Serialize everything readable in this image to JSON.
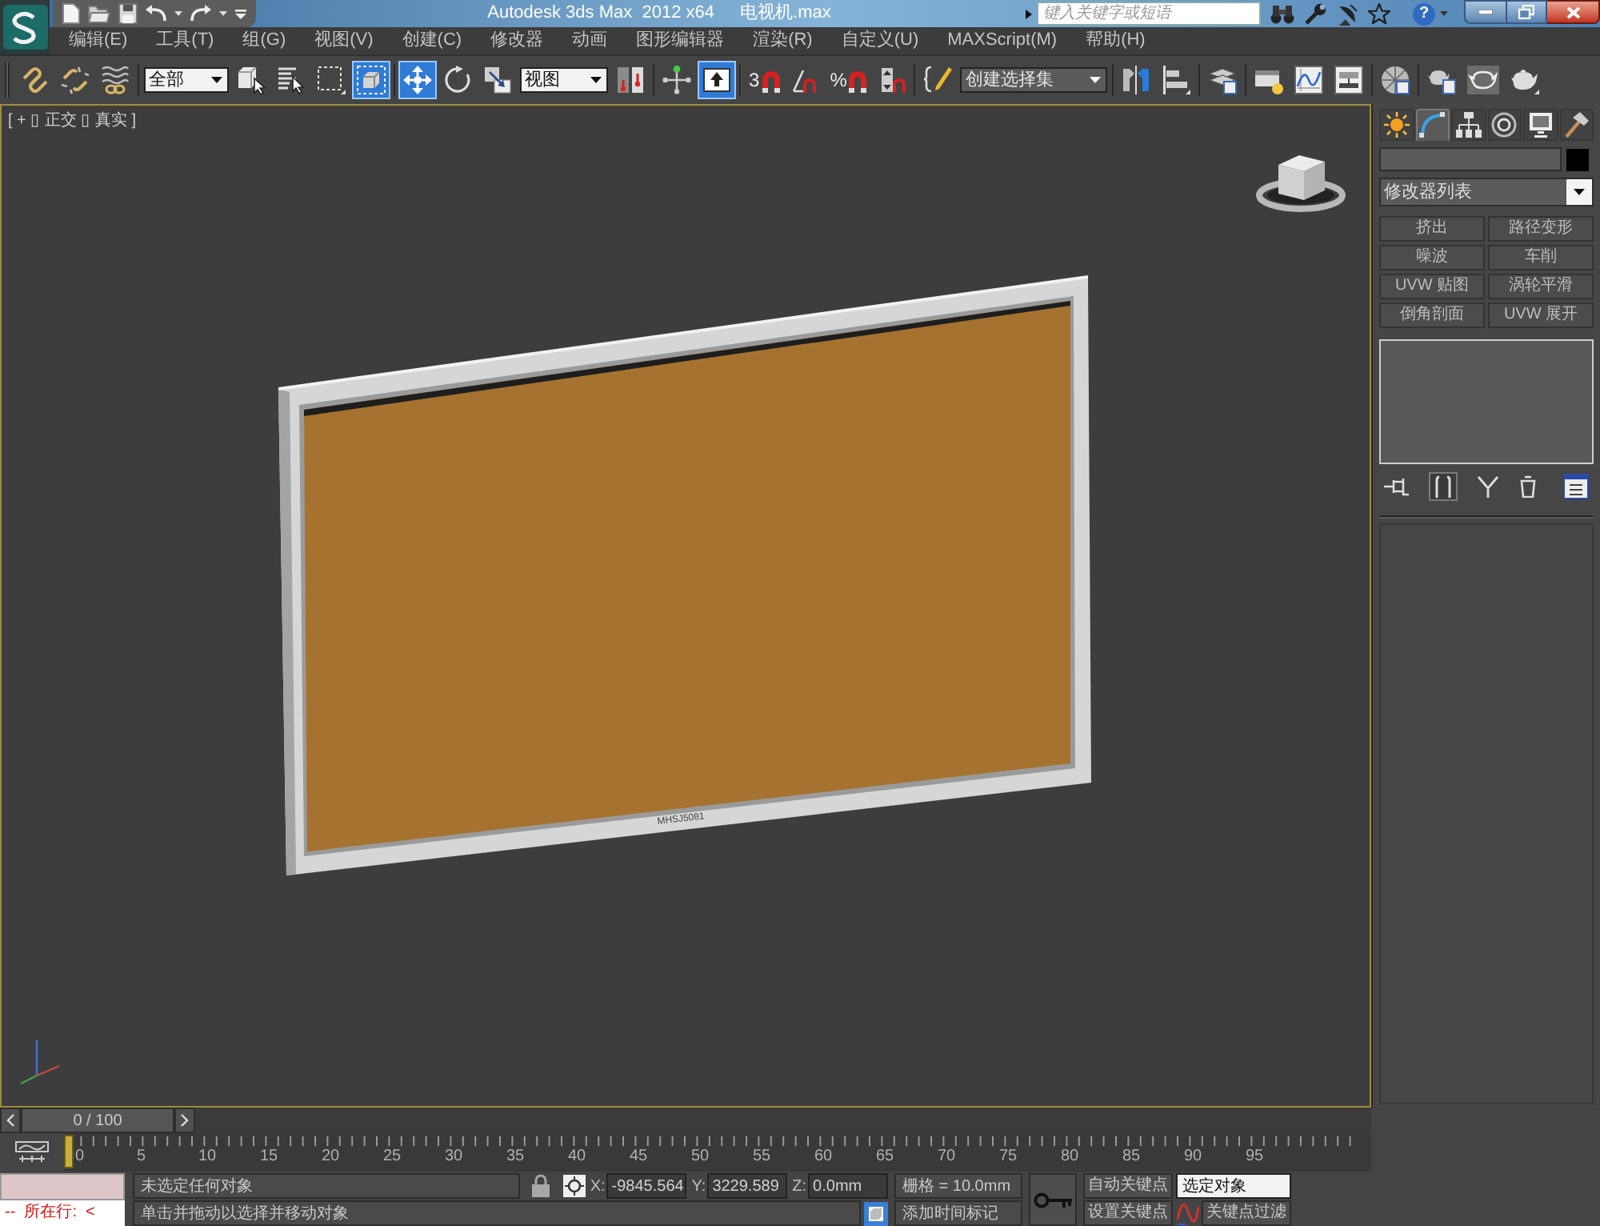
{
  "title_bar": {
    "app_title": "Autodesk 3ds Max  2012 x64",
    "file_name": "电视机.max",
    "search": {
      "placeholder": "键入关键字或短语"
    },
    "help": "?"
  },
  "menu_bar": [
    "编辑(E)",
    "工具(T)",
    "组(G)",
    "视图(V)",
    "创建(C)",
    "修改器",
    "动画",
    "图形编辑器",
    "渲染(R)",
    "自定义(U)",
    "MAXScript(M)",
    "帮助(H)"
  ],
  "main_toolbar": [
    {
      "items": [
        {
          "kind": "button",
          "selected": false
        },
        {
          "kind": "button",
          "selected": false
        },
        {
          "kind": "button",
          "selected": false
        }
      ]
    },
    {
      "items": [
        {
          "kind": "dropdown",
          "value": "全部"
        },
        {
          "kind": "button",
          "selected": false
        },
        {
          "kind": "button",
          "selected": false
        },
        {
          "kind": "button",
          "selected": false
        },
        {
          "kind": "button",
          "selected": true
        }
      ]
    },
    {
      "items": [
        {
          "kind": "button",
          "selected": true
        },
        {
          "kind": "button",
          "selected": false
        },
        {
          "kind": "button",
          "selected": false
        },
        {
          "kind": "dropdown",
          "value": "视图"
        },
        {
          "kind": "button",
          "selected": false
        }
      ]
    },
    {
      "items": [
        {
          "kind": "button",
          "selected": false
        },
        {
          "kind": "button",
          "selected": true
        }
      ]
    },
    {
      "items": [
        {
          "kind": "button",
          "selected": false,
          "label": "3"
        },
        {
          "kind": "button",
          "selected": false
        },
        {
          "kind": "button",
          "selected": false,
          "label": "%"
        },
        {
          "kind": "button",
          "selected": false
        }
      ]
    },
    {
      "items": [
        {
          "kind": "button",
          "selected": false
        },
        {
          "kind": "dropdown",
          "value": "创建选择集"
        }
      ]
    },
    {
      "items": [
        {
          "kind": "button",
          "selected": false
        },
        {
          "kind": "button",
          "selected": false
        }
      ]
    },
    {
      "items": [
        {
          "kind": "button",
          "selected": false
        }
      ]
    },
    {
      "items": [
        {
          "kind": "button",
          "selected": false
        },
        {
          "kind": "button",
          "selected": false
        },
        {
          "kind": "button",
          "selected": false
        }
      ]
    },
    {
      "items": [
        {
          "kind": "button",
          "selected": false
        }
      ]
    },
    {
      "items": [
        {
          "kind": "button",
          "selected": false
        },
        {
          "kind": "button",
          "selected": false
        },
        {
          "kind": "button",
          "selected": false
        }
      ]
    }
  ],
  "viewport": {
    "label": "[ + ▯ 正交 ▯ 真实 ]",
    "model_label": "MHSJ5081"
  },
  "command_panel": {
    "tabs": [
      {
        "selected": false
      },
      {
        "selected": true
      },
      {
        "selected": false
      },
      {
        "selected": false
      },
      {
        "selected": false
      },
      {
        "selected": false
      }
    ],
    "modifier_list": "修改器列表",
    "modifier_buttons": [
      "挤出",
      "路径变形",
      "噪波",
      "车削",
      "UVW 贴图",
      "涡轮平滑",
      "倒角剖面",
      "UVW 展开"
    ],
    "stack_tools": [
      {
        "selected": false
      },
      {
        "selected": true
      },
      {
        "selected": false
      },
      {
        "selected": false
      },
      {
        "selected": false
      }
    ]
  },
  "time_slider": {
    "position": "0 / 100",
    "level": 0
  },
  "track_bar": {
    "labels": [
      "0",
      "5",
      "10",
      "15",
      "20",
      "25",
      "30",
      "35",
      "40",
      "45",
      "50",
      "55",
      "60",
      "65",
      "70",
      "75",
      "80",
      "85",
      "90",
      "95"
    ]
  },
  "status_bar": {
    "listener_output": "--  所在行:  <",
    "selection_info": "未选定任何对象",
    "prompt": "单击并拖动以选择并移动对象",
    "coordinates": [
      {
        "axis": "X:",
        "value": "-9845.564"
      },
      {
        "axis": "Y:",
        "value": "3229.589"
      },
      {
        "axis": "Z:",
        "value": "0.0mm"
      }
    ],
    "grid": "栅格 = 10.0mm",
    "time_tag": "添加时间标记",
    "auto_key": "自动关键点",
    "set_key": "设置关键点",
    "key_mode": "选定对象",
    "key_filters": "关键点过滤"
  }
}
